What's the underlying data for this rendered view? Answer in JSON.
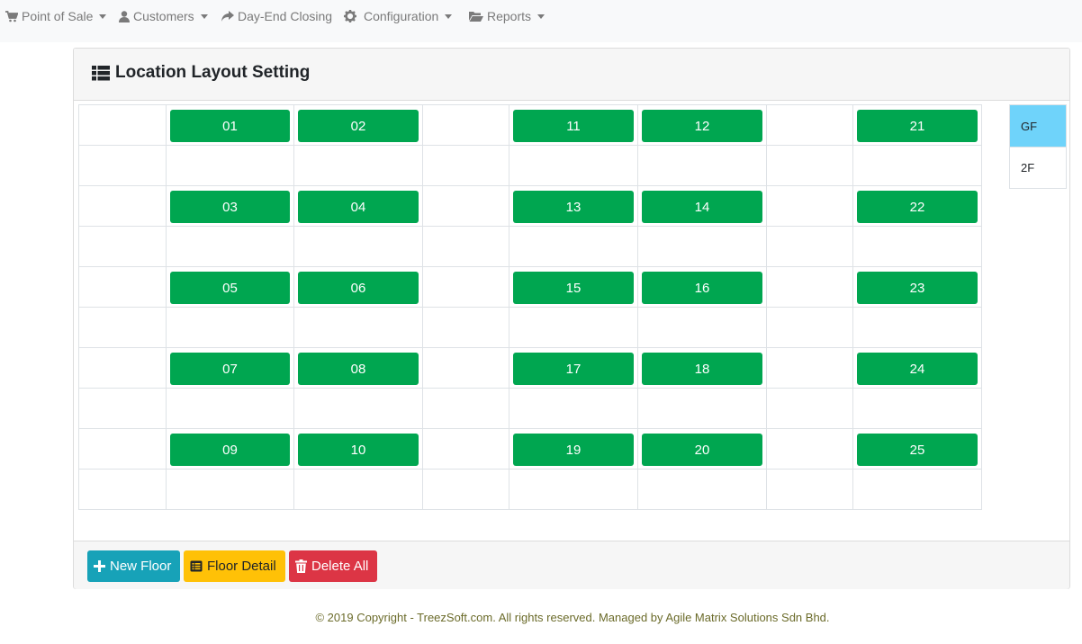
{
  "nav": {
    "items": [
      {
        "label": "Point of Sale",
        "icon": "cart-icon",
        "dropdown": true
      },
      {
        "label": "Customers",
        "icon": "user-icon",
        "dropdown": true
      },
      {
        "label": "Day-End Closing",
        "icon": "share-icon",
        "dropdown": false
      },
      {
        "label": "Configuration",
        "icon": "gear-icon",
        "dropdown": true
      },
      {
        "label": "Reports",
        "icon": "folder-open-icon",
        "dropdown": true
      }
    ]
  },
  "card": {
    "title": "Location Layout Setting",
    "title_icon": "list-icon"
  },
  "grid": {
    "locations": [
      [
        "",
        "01",
        "02",
        "",
        "11",
        "12",
        "",
        "21"
      ],
      [
        "",
        "",
        "",
        "",
        "",
        "",
        "",
        ""
      ],
      [
        "",
        "03",
        "04",
        "",
        "13",
        "14",
        "",
        "22"
      ],
      [
        "",
        "",
        "",
        "",
        "",
        "",
        "",
        ""
      ],
      [
        "",
        "05",
        "06",
        "",
        "15",
        "16",
        "",
        "23"
      ],
      [
        "",
        "",
        "",
        "",
        "",
        "",
        "",
        ""
      ],
      [
        "",
        "07",
        "08",
        "",
        "17",
        "18",
        "",
        "24"
      ],
      [
        "",
        "",
        "",
        "",
        "",
        "",
        "",
        ""
      ],
      [
        "",
        "09",
        "10",
        "",
        "19",
        "20",
        "",
        "25"
      ],
      [
        "",
        "",
        "",
        "",
        "",
        "",
        "",
        ""
      ]
    ],
    "location_color": "#00a650"
  },
  "floors": {
    "items": [
      "GF",
      "2F"
    ],
    "selected": "GF",
    "active_color": "#6fd3fa"
  },
  "actions": {
    "new_floor": "New Floor",
    "floor_detail": "Floor Detail",
    "delete_all": "Delete All"
  },
  "footer": {
    "copyright": "© 2019 Copyright - TreezSoft.com. All rights reserved. Managed by Agile Matrix Solutions Sdn Bhd."
  }
}
